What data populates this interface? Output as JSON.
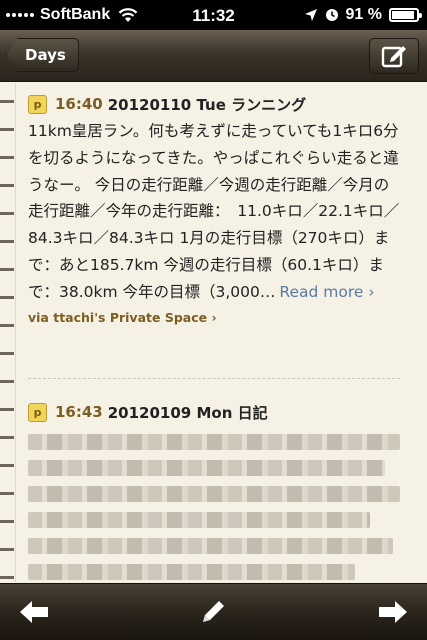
{
  "status": {
    "carrier": "SoftBank",
    "time": "11:32",
    "battery": "91 %",
    "battery_level": 0.91
  },
  "nav": {
    "back_label": "Days"
  },
  "entries": [
    {
      "badge": "p",
      "time": "16:40",
      "title": "20120110 Tue ランニング",
      "body": "11km皇居ラン。何も考えずに走っていても1キロ6分を切るようになってきた。やっぱこれぐらい走ると違うなー。 今日の走行距離／今週の走行距離／今月の走行距離／今年の走行距離：　11.0キロ／22.1キロ／84.3キロ／84.3キロ 1月の走行目標（270キロ）まで：あと185.7km 今週の走行目標（60.1キロ）まで：38.0km 今年の目標（3,000…",
      "read_more": "Read more ›",
      "via": "via ttachi's Private Space ›"
    },
    {
      "badge": "p",
      "time": "16:43",
      "title": "20120109 Mon 日記"
    }
  ]
}
